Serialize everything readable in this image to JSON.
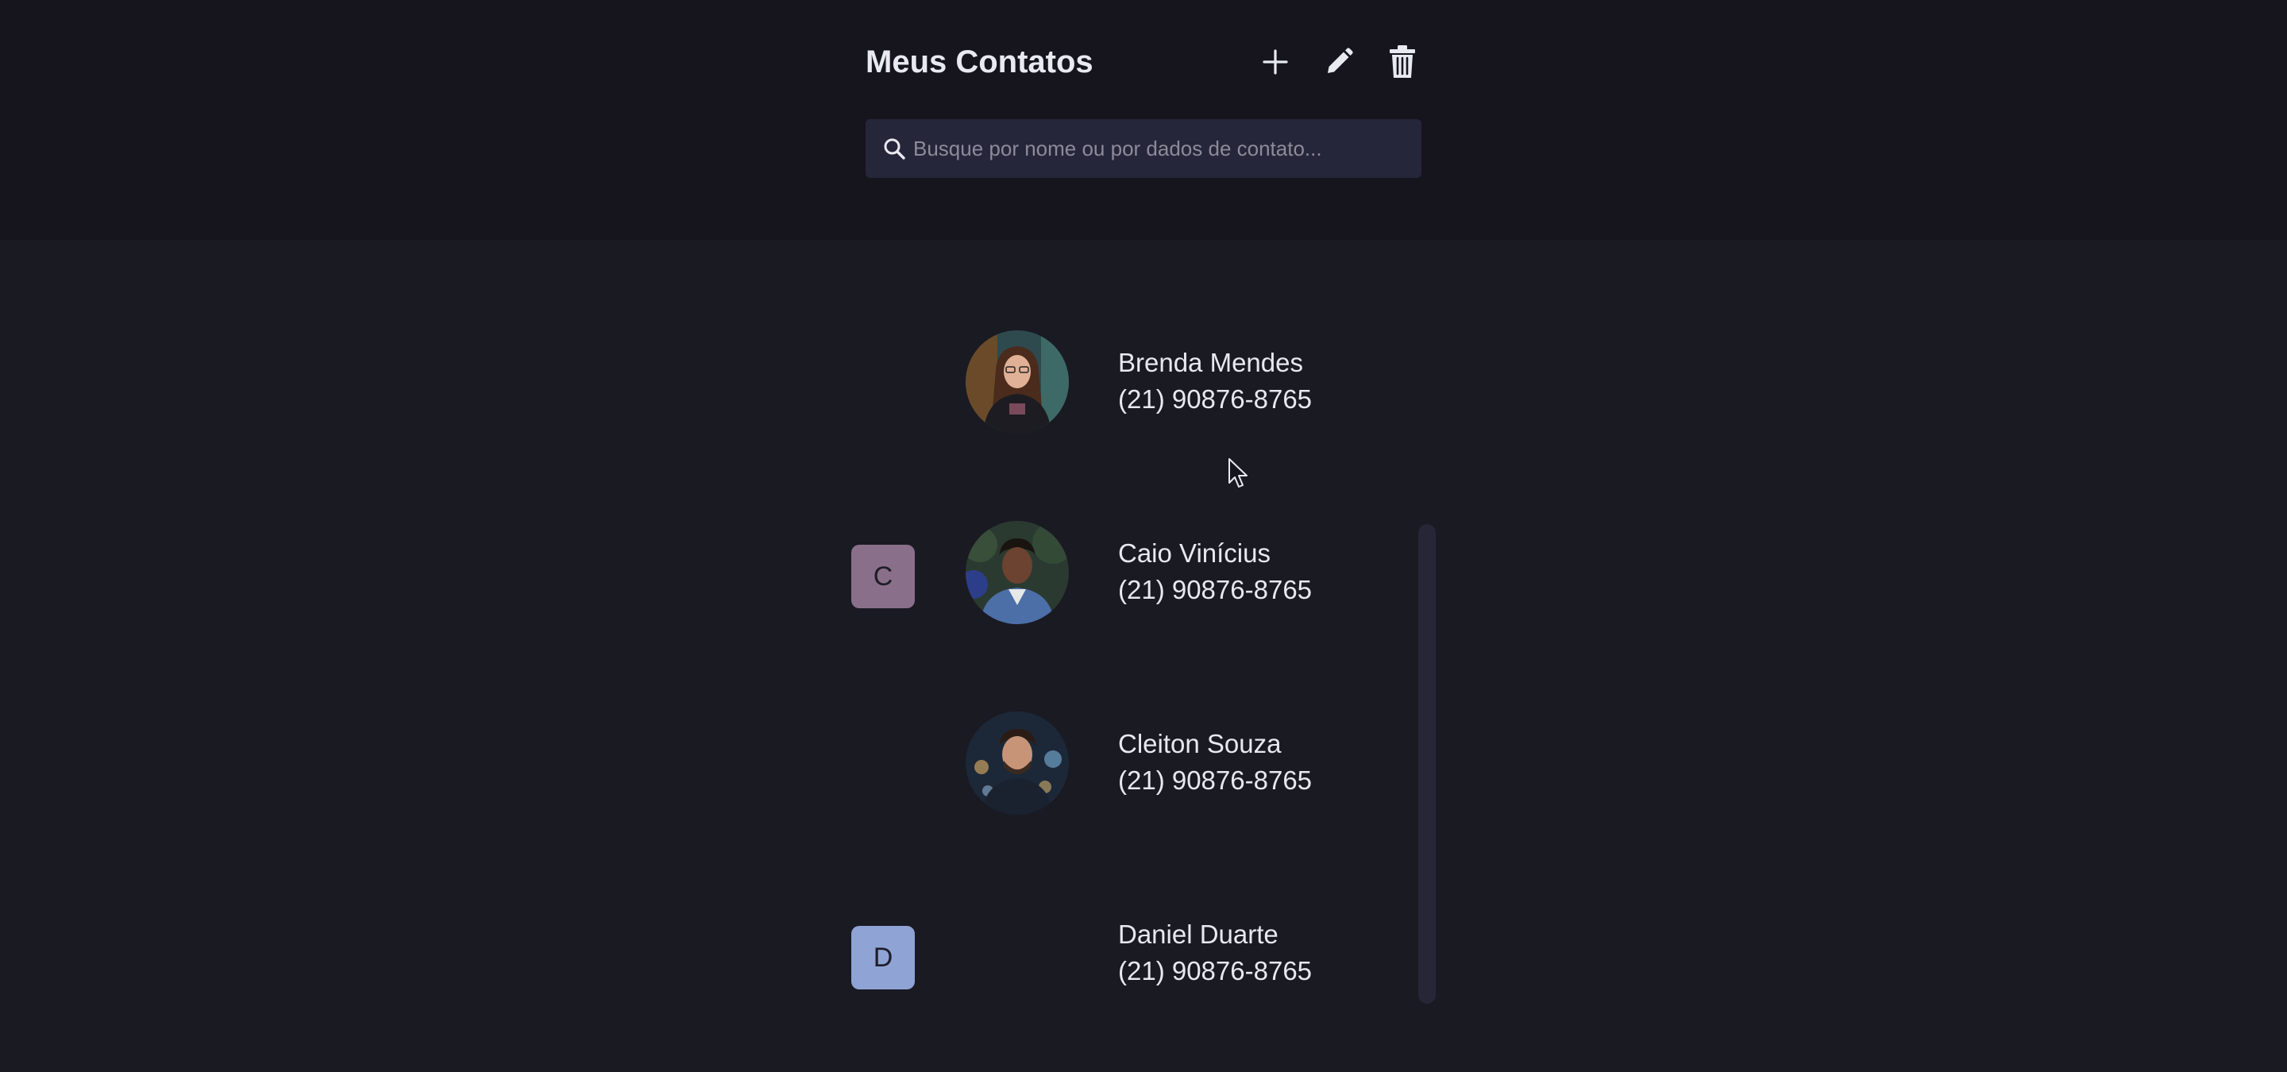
{
  "header": {
    "title": "Meus Contatos",
    "actions": [
      {
        "name": "add-contact-button",
        "icon": "plus-icon"
      },
      {
        "name": "edit-contact-button",
        "icon": "pencil-icon"
      },
      {
        "name": "delete-contact-button",
        "icon": "trash-icon"
      }
    ]
  },
  "search": {
    "placeholder": "Busque por nome ou por dados de contato...",
    "value": "",
    "icon": "search-icon"
  },
  "contacts": [
    {
      "group": "",
      "name": "Brenda Mendes",
      "phone": "(21) 90876-8765",
      "avatar": "photo"
    },
    {
      "group": "C",
      "name": "Caio Vinícius",
      "phone": "(21) 90876-8765",
      "avatar": "photo"
    },
    {
      "group": "",
      "name": "Cleiton Souza",
      "phone": "(21) 90876-8765",
      "avatar": "photo"
    },
    {
      "group": "D",
      "name": "Daniel Duarte",
      "phone": "(21) 90876-8765",
      "avatar": "none"
    }
  ],
  "colors": {
    "background": "#1a1a23",
    "header_background": "#16151e",
    "search_background": "#26263a",
    "group_c": "#8a6f8a",
    "group_d": "#8fa3d4"
  }
}
